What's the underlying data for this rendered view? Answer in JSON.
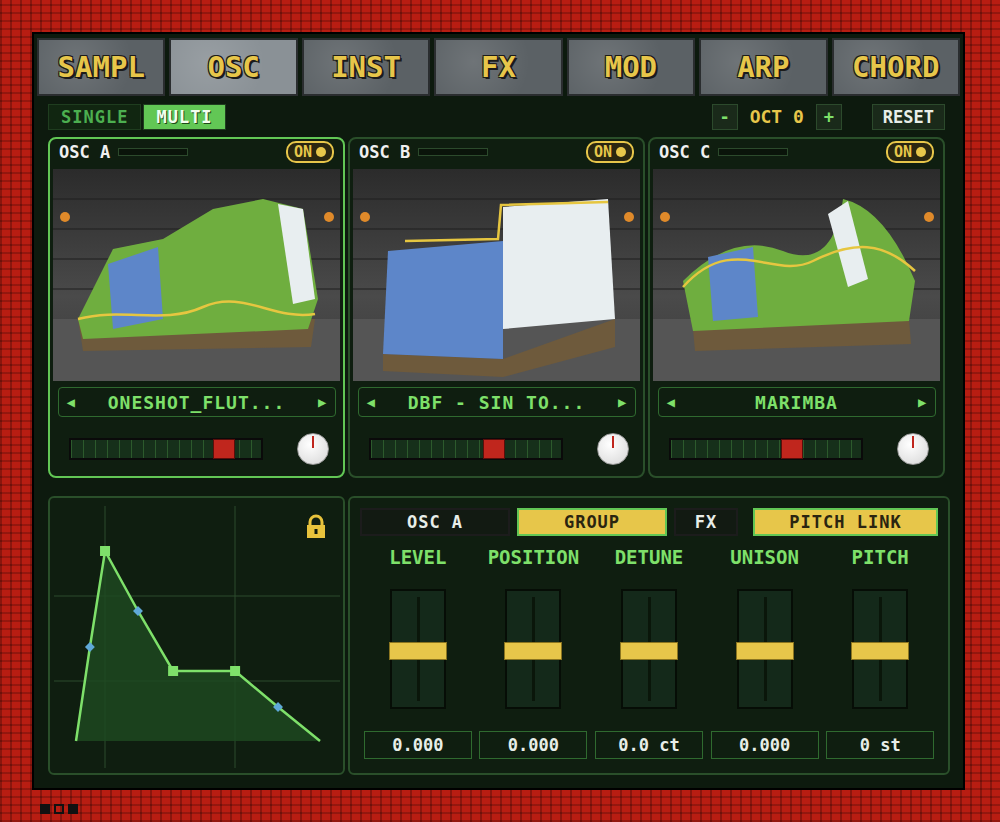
{
  "tabs": [
    {
      "label": "SAMPL",
      "selected": false
    },
    {
      "label": "OSC",
      "selected": true
    },
    {
      "label": "INST",
      "selected": false
    },
    {
      "label": "FX",
      "selected": false
    },
    {
      "label": "MOD",
      "selected": false
    },
    {
      "label": "ARP",
      "selected": false
    },
    {
      "label": "CHORD",
      "selected": false
    }
  ],
  "mode": [
    {
      "label": "SINGLE",
      "selected": false
    },
    {
      "label": "MULTI",
      "selected": true
    }
  ],
  "octave": {
    "minus": "-",
    "label": "OCT 0",
    "plus": "+"
  },
  "reset": "RESET",
  "oscillators": [
    {
      "name": "OSC A",
      "selected": true,
      "meter": 0,
      "on": true,
      "on_label": "ON",
      "prev": "◀",
      "next": "▶",
      "preset": "ONESHOT_FLUT...",
      "level": 0.81,
      "knob": 0.5
    },
    {
      "name": "OSC B",
      "selected": false,
      "meter": 0,
      "on": true,
      "on_label": "ON",
      "prev": "◀",
      "next": "▶",
      "preset": "DBF - SIN TO...",
      "level": 0.65,
      "knob": 0.5
    },
    {
      "name": "OSC C",
      "selected": false,
      "meter": 0,
      "on": true,
      "on_label": "ON",
      "prev": "◀",
      "next": "▶",
      "preset": "MARIMBA",
      "level": 0.64,
      "knob": 0.5
    }
  ],
  "envelope": {
    "locked": true,
    "points": [
      {
        "x": 0,
        "y": 0,
        "kind": "end"
      },
      {
        "x": 0.057,
        "y": 0.47,
        "kind": "handle"
      },
      {
        "x": 0.119,
        "y": 0.95,
        "kind": "node"
      },
      {
        "x": 0.254,
        "y": 0.65,
        "kind": "handle"
      },
      {
        "x": 0.398,
        "y": 0.35,
        "kind": "node"
      },
      {
        "x": 0.652,
        "y": 0.35,
        "kind": "node"
      },
      {
        "x": 0.828,
        "y": 0.17,
        "kind": "handle"
      },
      {
        "x": 1,
        "y": 0,
        "kind": "end"
      }
    ]
  },
  "controls": {
    "header": [
      {
        "label": "OSC A",
        "kind": "target",
        "selected": false
      },
      {
        "label": "GROUP",
        "kind": "toggle",
        "selected": true
      },
      {
        "label": "FX",
        "kind": "toggle",
        "selected": false
      },
      {
        "label": "PITCH LINK",
        "kind": "toggle",
        "selected": true
      }
    ],
    "faders": [
      {
        "label": "LEVEL",
        "level": 0.5,
        "value": "0.000"
      },
      {
        "label": "POSITION",
        "level": 0.5,
        "value": "0.000"
      },
      {
        "label": "DETUNE",
        "level": 0.5,
        "value": "0.0 ct"
      },
      {
        "label": "UNISON",
        "level": 0.5,
        "value": "0.000"
      },
      {
        "label": "PITCH",
        "level": 0.5,
        "value": "0 st"
      }
    ]
  }
}
